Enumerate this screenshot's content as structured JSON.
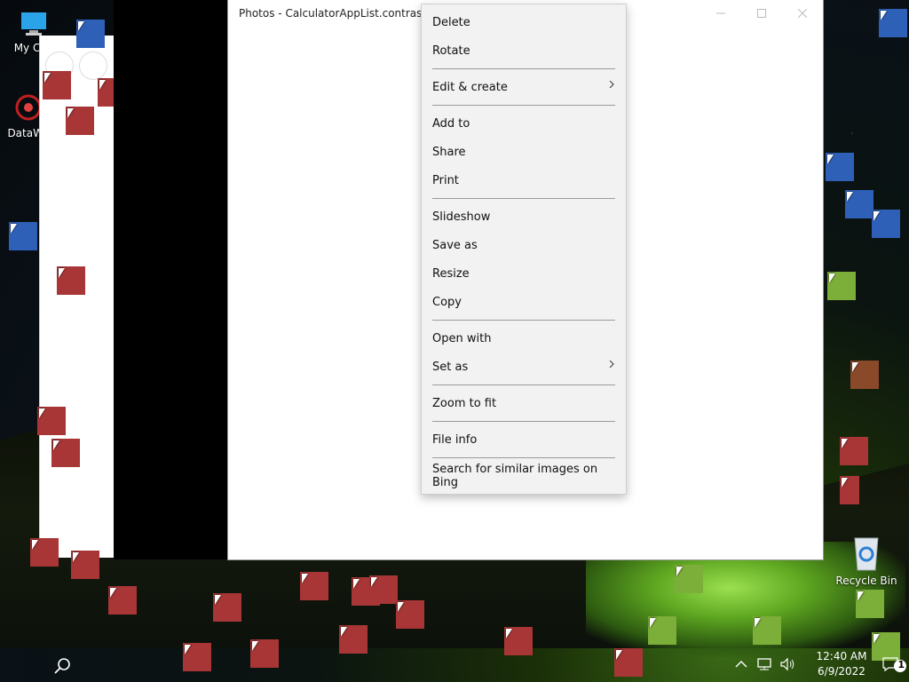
{
  "window": {
    "title": "Photos - CalculatorAppList.contrast-bla"
  },
  "desktop": {
    "icons": [
      {
        "label": "My Con"
      },
      {
        "label": "DataWa"
      },
      {
        "label": "Recycle Bin"
      }
    ]
  },
  "context_menu": {
    "items": [
      {
        "label": "Delete"
      },
      {
        "label": "Rotate"
      },
      {
        "label": "Edit & create",
        "submenu": true
      },
      {
        "label": "Add to"
      },
      {
        "label": "Share"
      },
      {
        "label": "Print"
      },
      {
        "label": "Slideshow"
      },
      {
        "label": "Save as"
      },
      {
        "label": "Resize"
      },
      {
        "label": "Copy"
      },
      {
        "label": "Open with"
      },
      {
        "label": "Set as",
        "submenu": true
      },
      {
        "label": "Zoom to fit"
      },
      {
        "label": "File info"
      },
      {
        "label": "Search for similar images on Bing"
      }
    ]
  },
  "taskbar": {
    "time": "12:40 AM",
    "date": "6/9/2022",
    "notification_count": "1"
  },
  "icons": {
    "search": "search-icon",
    "chevron": "chevron-right-icon",
    "network": "network-icon",
    "volume": "volume-icon",
    "up_arrow": "chevron-up-icon",
    "notification": "notification-icon"
  }
}
